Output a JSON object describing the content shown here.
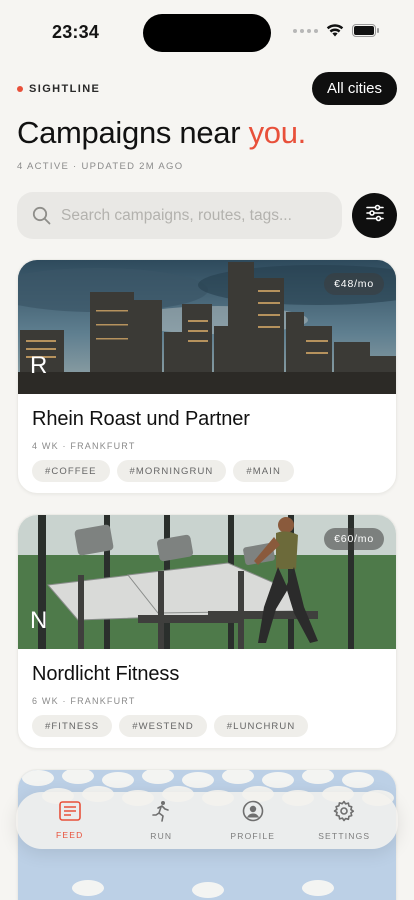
{
  "status_bar": {
    "time": "23:34"
  },
  "header": {
    "brand": "SIGHTLINE",
    "city_button": "All cities",
    "title_main": "Campaigns near ",
    "title_accent": "you.",
    "meta": "4 ACTIVE · UPDATED 2M AGO"
  },
  "search": {
    "placeholder": "Search campaigns, routes, tags..."
  },
  "cards": [
    {
      "letter": "R",
      "price": "€48/mo",
      "title": "Rhein Roast und Partner",
      "meta": "4 WK · FRANKFURT",
      "tags": [
        "#COFFEE",
        "#MORNINGRUN",
        "#MAIN"
      ],
      "image": "frankfurt-skyline-photo"
    },
    {
      "letter": "N",
      "price": "€60/mo",
      "title": "Nordlicht Fitness",
      "meta": "6 WK · FRANKFURT",
      "tags": [
        "#FITNESS",
        "#WESTEND",
        "#LUNCHRUN"
      ],
      "image": "treadmill-gym-photo"
    }
  ],
  "tab_bar": {
    "tabs": [
      {
        "label": "FEED",
        "icon": "feed-icon",
        "active": true
      },
      {
        "label": "RUN",
        "icon": "runner-icon",
        "active": false
      },
      {
        "label": "PROFILE",
        "icon": "profile-icon",
        "active": false
      },
      {
        "label": "SETTINGS",
        "icon": "gear-icon",
        "active": false
      }
    ]
  },
  "colors": {
    "accent": "#e8503a",
    "dark": "#0f0f0f",
    "background": "#f6f5f2"
  }
}
